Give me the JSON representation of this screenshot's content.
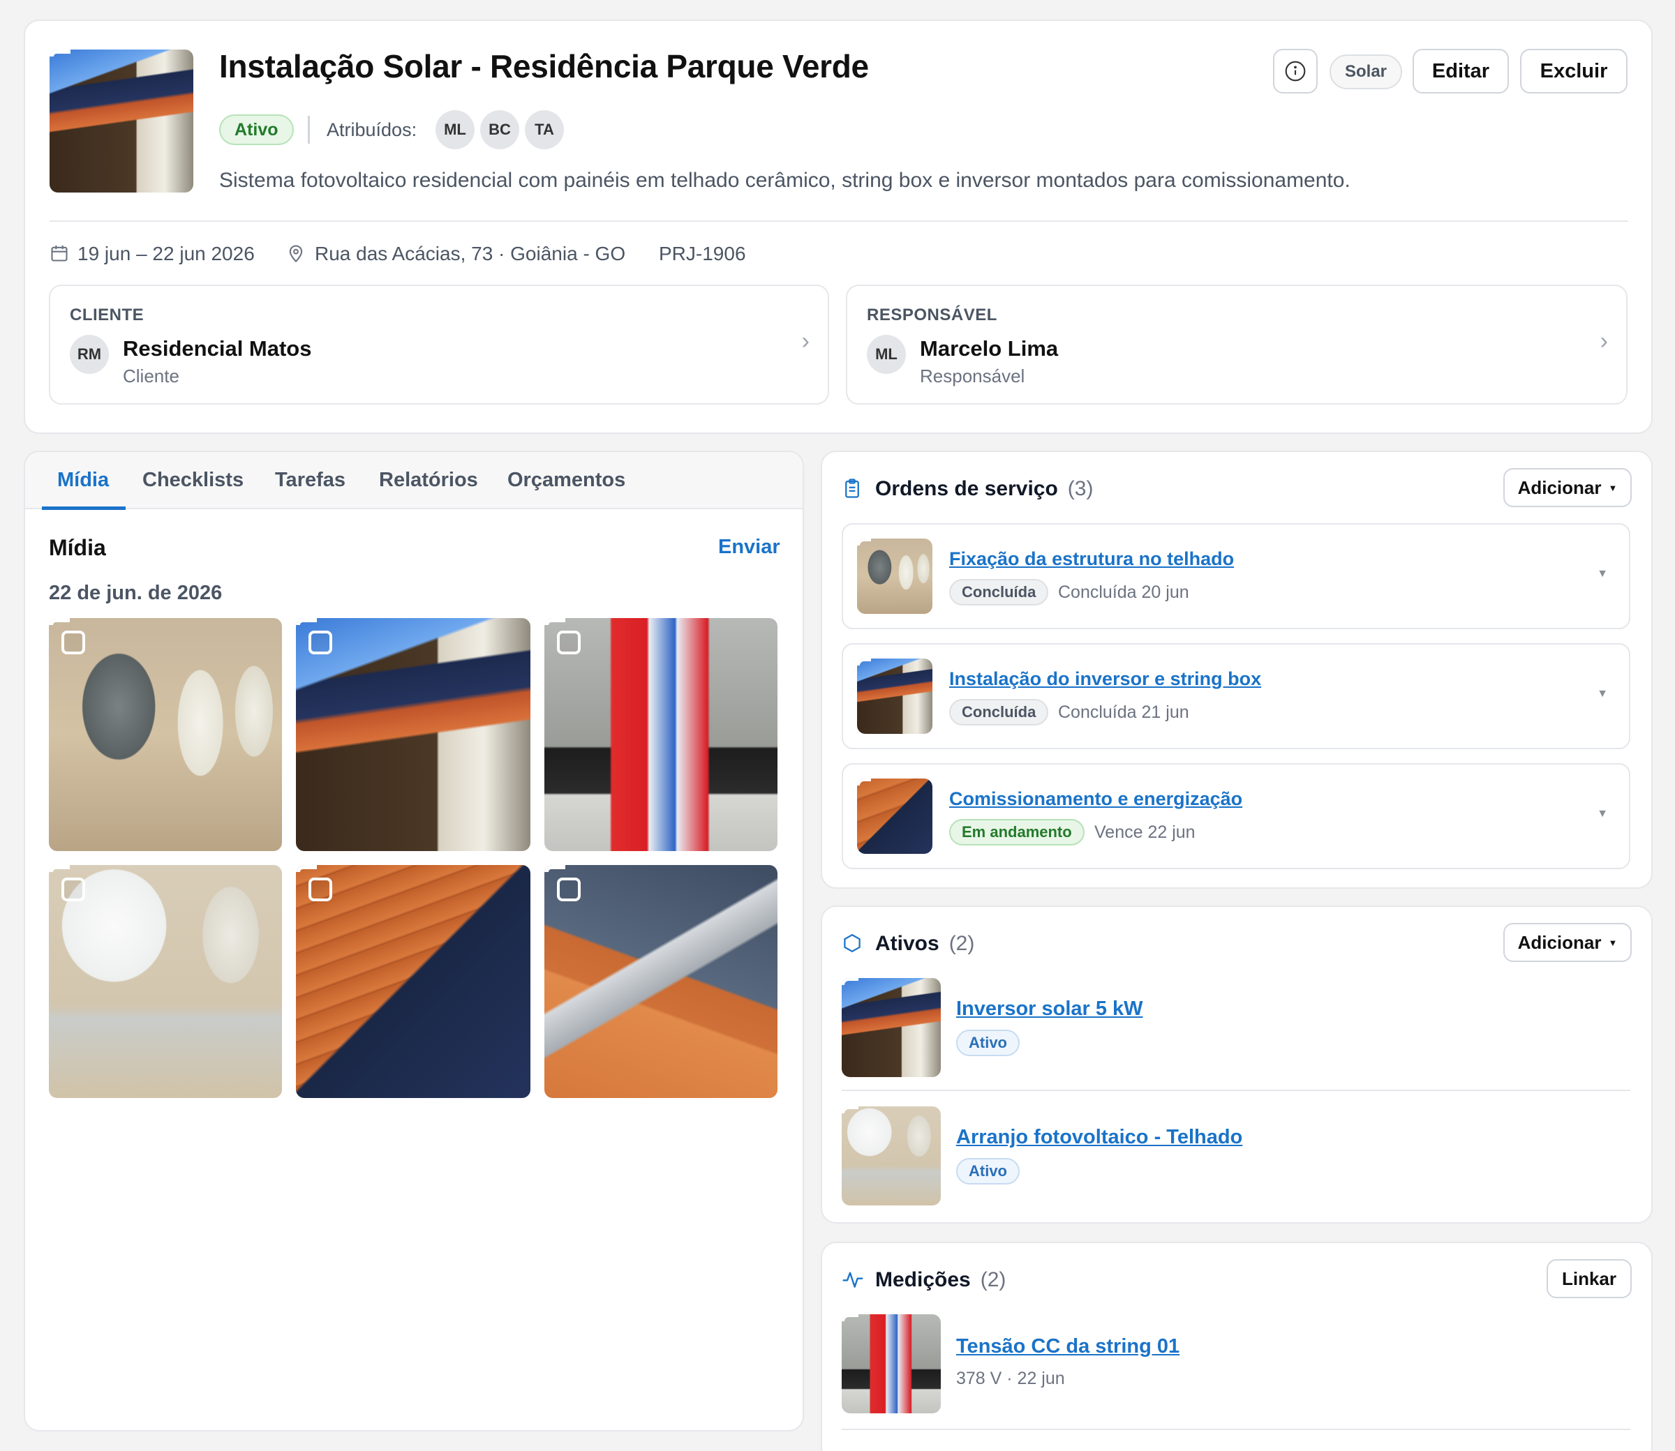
{
  "project": {
    "title": "Instalação Solar - Residência Parque Verde",
    "status": "Ativo",
    "assigned_label": "Atribuídos:",
    "assignees": [
      "ML",
      "BC",
      "TA"
    ],
    "description": "Sistema fotovoltaico residencial com painéis em telhado cerâmico, string box e inversor montados para comissionamento.",
    "tag": "Solar",
    "edit_label": "Editar",
    "delete_label": "Excluir",
    "dates": "19 jun – 22 jun 2026",
    "address": "Rua das Acácias, 73 · Goiânia - GO",
    "code": "PRJ-1906"
  },
  "client": {
    "section_label": "CLIENTE",
    "initials": "RM",
    "name": "Residencial Matos",
    "role": "Cliente"
  },
  "responsible": {
    "section_label": "RESPONSÁVEL",
    "initials": "ML",
    "name": "Marcelo Lima",
    "role": "Responsável"
  },
  "tabs": [
    "Mídia",
    "Checklists",
    "Tarefas",
    "Relatórios",
    "Orçamentos"
  ],
  "active_tab": "Mídia",
  "media": {
    "heading": "Mídia",
    "send_label": "Enviar",
    "date_group": "22 de jun. de 2026"
  },
  "service_orders": {
    "title": "Ordens de serviço",
    "count": "(3)",
    "add_label": "Adicionar",
    "items": [
      {
        "title": "Fixação da estrutura no telhado",
        "status": "Concluída",
        "meta": "Concluída 20 jun"
      },
      {
        "title": "Instalação do inversor e string box",
        "status": "Concluída",
        "meta": "Concluída 21 jun"
      },
      {
        "title": "Comissionamento e energização",
        "status": "Em andamento",
        "meta": "Vence 22 jun"
      }
    ]
  },
  "assets": {
    "title": "Ativos",
    "count": "(2)",
    "add_label": "Adicionar",
    "items": [
      {
        "title": "Inversor solar 5 kW",
        "status": "Ativo"
      },
      {
        "title": "Arranjo fotovoltaico - Telhado",
        "status": "Ativo"
      }
    ]
  },
  "measurements": {
    "title": "Medições",
    "count": "(2)",
    "link_label": "Linkar",
    "items": [
      {
        "title": "Tensão CC da string 01",
        "meta": "378 V · 22 jun"
      }
    ]
  },
  "colors": {
    "accent": "#1a73c8",
    "status_green": "#237a2b",
    "background": "#f2f3f2"
  }
}
